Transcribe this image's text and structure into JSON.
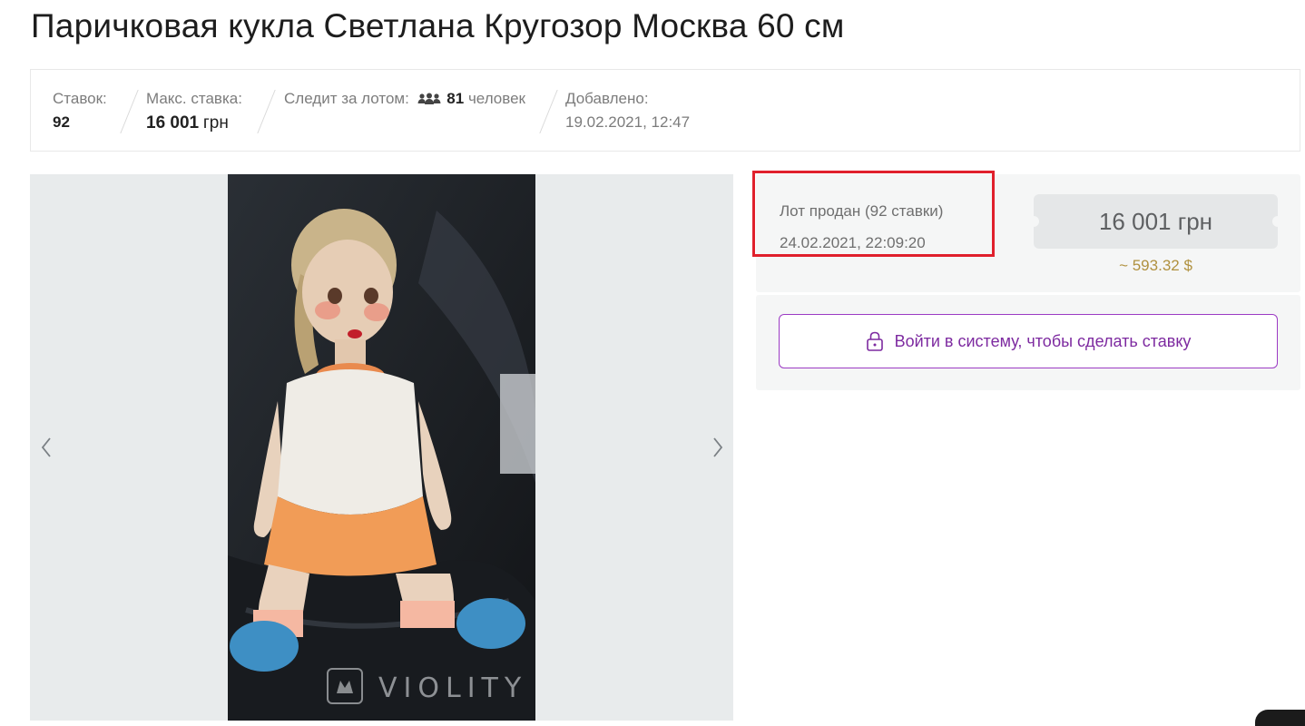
{
  "lot": {
    "title": "Паричковая кукла Светлана Кругозор Москва 60 см"
  },
  "stats": {
    "bids_label": "Ставок:",
    "bids_value": "92",
    "max_bid_label": "Макс. ставка:",
    "max_bid_amount": "16 001",
    "max_bid_currency": "грн",
    "watchers_label": "Следит за лотом:",
    "watchers_icon": "users-icon",
    "watchers_count": "81",
    "watchers_suffix": "человек",
    "added_label": "Добавлено:",
    "added_value": "19.02.2021, 12:47"
  },
  "gallery": {
    "prev_icon": "chevron-left-icon",
    "next_icon": "chevron-right-icon",
    "watermark": "VIOLITY"
  },
  "status": {
    "sold_text": "Лот продан (92 ставки)",
    "sold_date": "24.02.2021, 22:09:20",
    "final_price": "16 001 грн",
    "usd_price": "~ 593.32 $",
    "highlight_color": "#e0202c"
  },
  "login": {
    "icon": "lock-icon",
    "label": "Войти в систему, чтобы сделать ставку",
    "accent_color": "#9c3bc4"
  }
}
